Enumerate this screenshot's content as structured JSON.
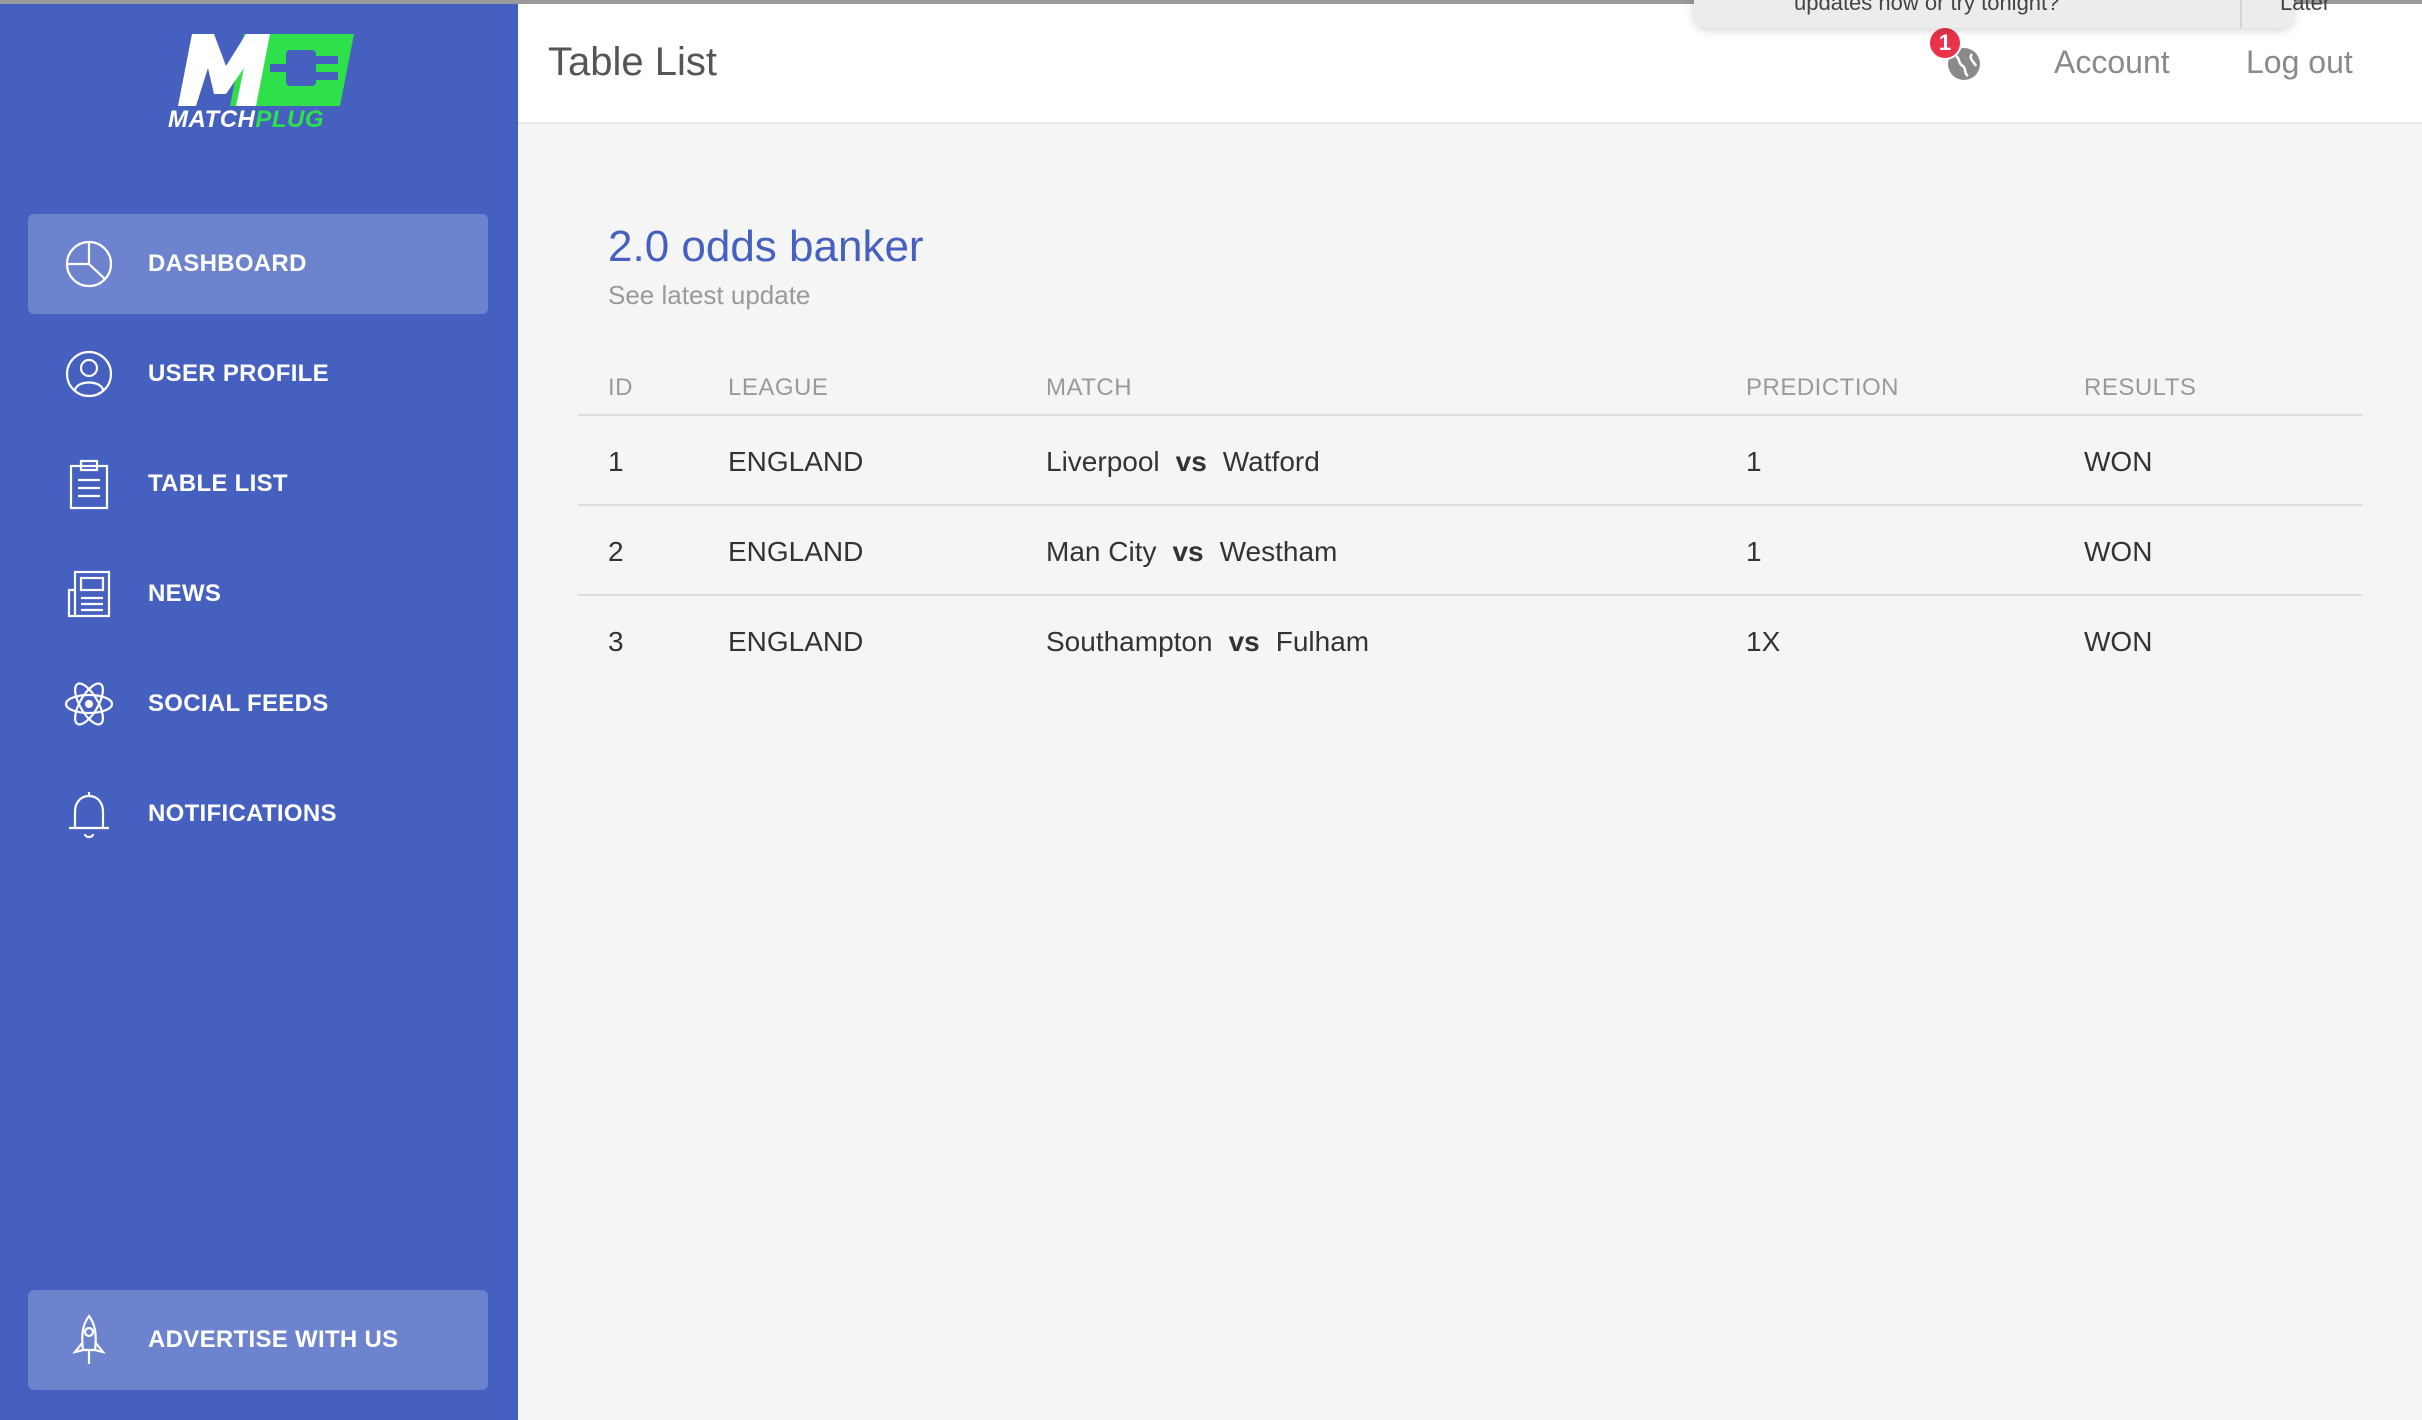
{
  "header": {
    "title": "Table List",
    "notification_count": "1",
    "account_label": "Account",
    "logout_label": "Log out"
  },
  "popup": {
    "message": "updates now or try tonight?",
    "later_label": "Later"
  },
  "brand": {
    "word_part1": "MATCH",
    "word_part2": "PLUG",
    "accent_color": "#2ee04a",
    "sidebar_color": "#4660bf"
  },
  "sidebar": {
    "items": [
      {
        "label": "DASHBOARD",
        "icon": "pie-chart-icon",
        "active": true
      },
      {
        "label": "USER PROFILE",
        "icon": "user-icon"
      },
      {
        "label": "TABLE LIST",
        "icon": "clipboard-icon"
      },
      {
        "label": "NEWS",
        "icon": "newspaper-icon"
      },
      {
        "label": "SOCIAL FEEDS",
        "icon": "atom-icon"
      },
      {
        "label": "NOTIFICATIONS",
        "icon": "bell-icon"
      }
    ],
    "bottom": {
      "label": "ADVERTISE WITH US",
      "icon": "rocket-icon"
    }
  },
  "card": {
    "title": "2.0 odds banker",
    "subtitle": "See latest update"
  },
  "table": {
    "columns": [
      "ID",
      "LEAGUE",
      "MATCH",
      "PREDICTION",
      "RESULTS"
    ],
    "vs_label": "vs",
    "rows": [
      {
        "id": "1",
        "league": "ENGLAND",
        "home": "Liverpool",
        "away": "Watford",
        "prediction": "1",
        "result": "WON"
      },
      {
        "id": "2",
        "league": "ENGLAND",
        "home": "Man City",
        "away": "Westham",
        "prediction": "1",
        "result": "WON"
      },
      {
        "id": "3",
        "league": "ENGLAND",
        "home": "Southampton",
        "away": "Fulham",
        "prediction": "1X",
        "result": "WON"
      }
    ]
  }
}
